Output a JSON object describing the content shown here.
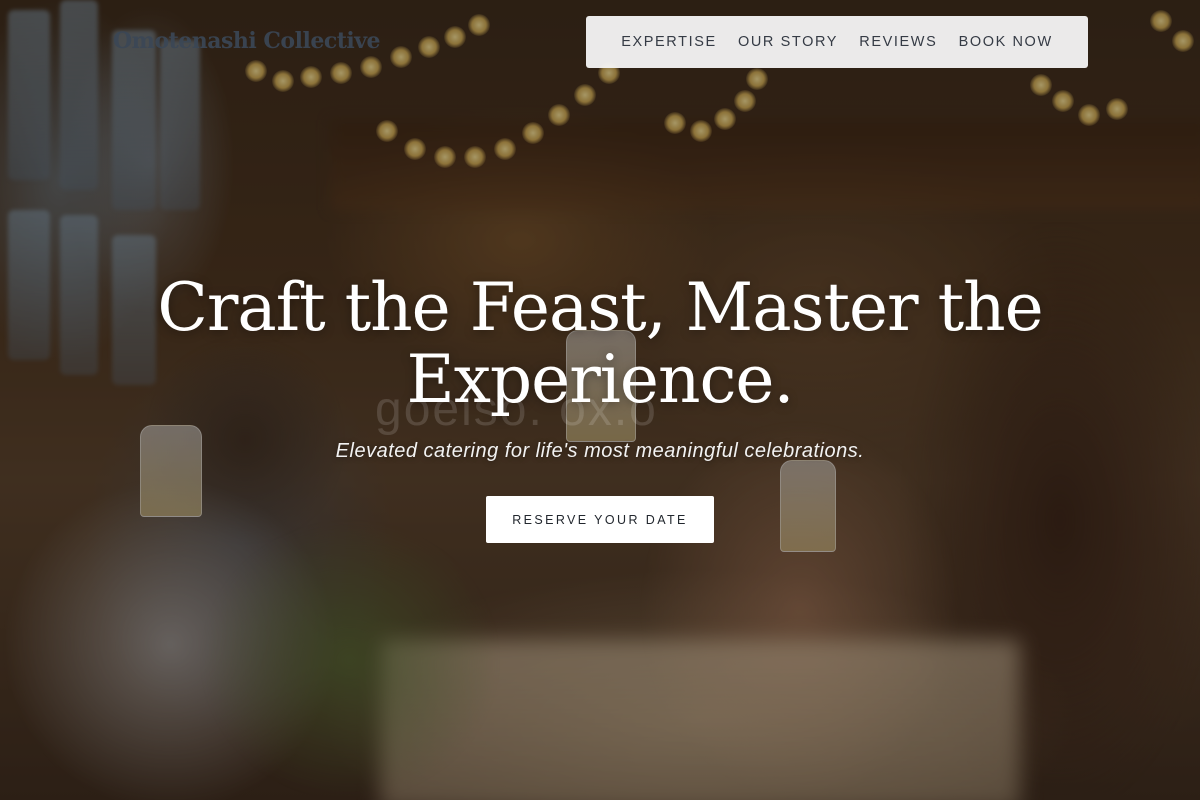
{
  "header": {
    "brand": "Omotenashi Collective",
    "nav": [
      {
        "label": "EXPERTISE"
      },
      {
        "label": "OUR STORY"
      },
      {
        "label": "REVIEWS"
      },
      {
        "label": "BOOK NOW"
      }
    ]
  },
  "hero": {
    "headline": "Craft the Feast, Master the Experience.",
    "subheadline": "Elevated catering for life's most meaningful celebrations.",
    "cta_label": "RESERVE YOUR DATE",
    "background_description_icon": "banquet-toast-photo",
    "watermark": "goelso. ox.o"
  },
  "colors": {
    "nav_bg": "#f5f5f5",
    "nav_text": "#353b45",
    "logo_text": "#3b4756",
    "headline_text": "#ffffff",
    "cta_bg": "#ffffff",
    "cta_text": "#22272e"
  }
}
